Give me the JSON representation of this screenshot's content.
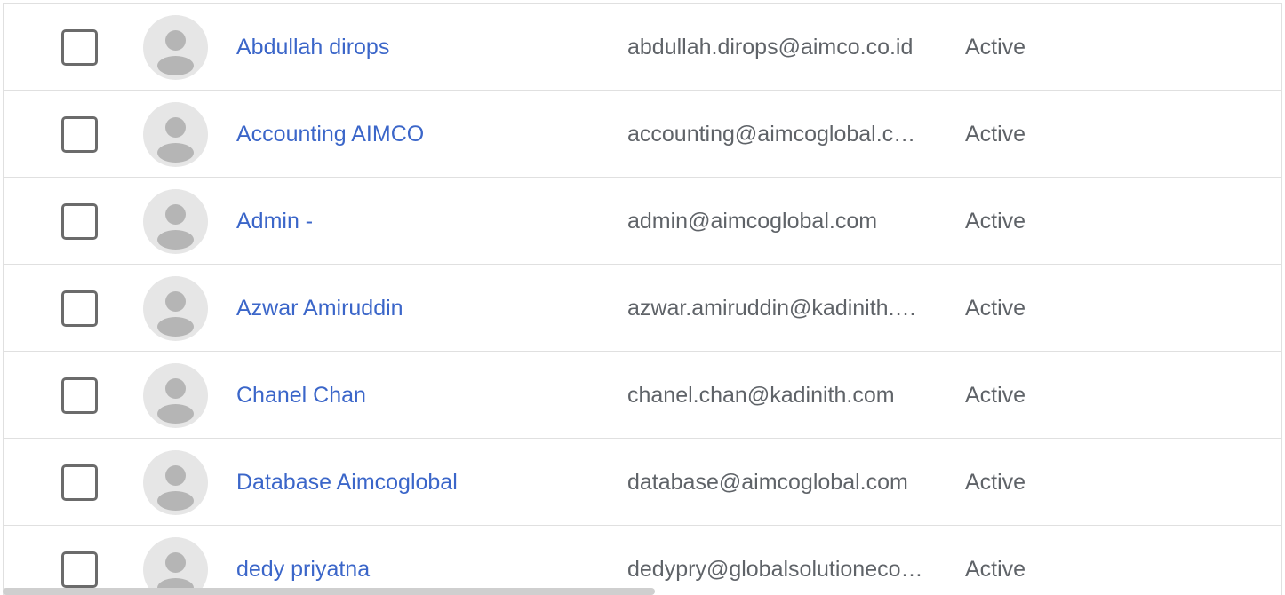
{
  "users": [
    {
      "name": "Abdullah dirops",
      "email": "abdullah.dirops@aimco.co.id",
      "status": "Active"
    },
    {
      "name": "Accounting AIMCO",
      "email": "accounting@aimcoglobal.c…",
      "status": "Active"
    },
    {
      "name": "Admin -",
      "email": "admin@aimcoglobal.com",
      "status": "Active"
    },
    {
      "name": "Azwar Amiruddin",
      "email": "azwar.amiruddin@kadinith.…",
      "status": "Active"
    },
    {
      "name": "Chanel Chan",
      "email": "chanel.chan@kadinith.com",
      "status": "Active"
    },
    {
      "name": "Database Aimcoglobal",
      "email": "database@aimcoglobal.com",
      "status": "Active"
    },
    {
      "name": "dedy priyatna",
      "email": "dedypry@globalsolutioneco…",
      "status": "Active"
    }
  ],
  "colors": {
    "link": "#3b66c9",
    "text_secondary": "#5f6368",
    "divider": "#e0e0e0",
    "avatar_bg": "#e6e6e6",
    "avatar_fg": "#b5b5b5"
  },
  "icons": {
    "checkbox": "checkbox-unchecked-icon",
    "avatar": "default-avatar-icon"
  }
}
